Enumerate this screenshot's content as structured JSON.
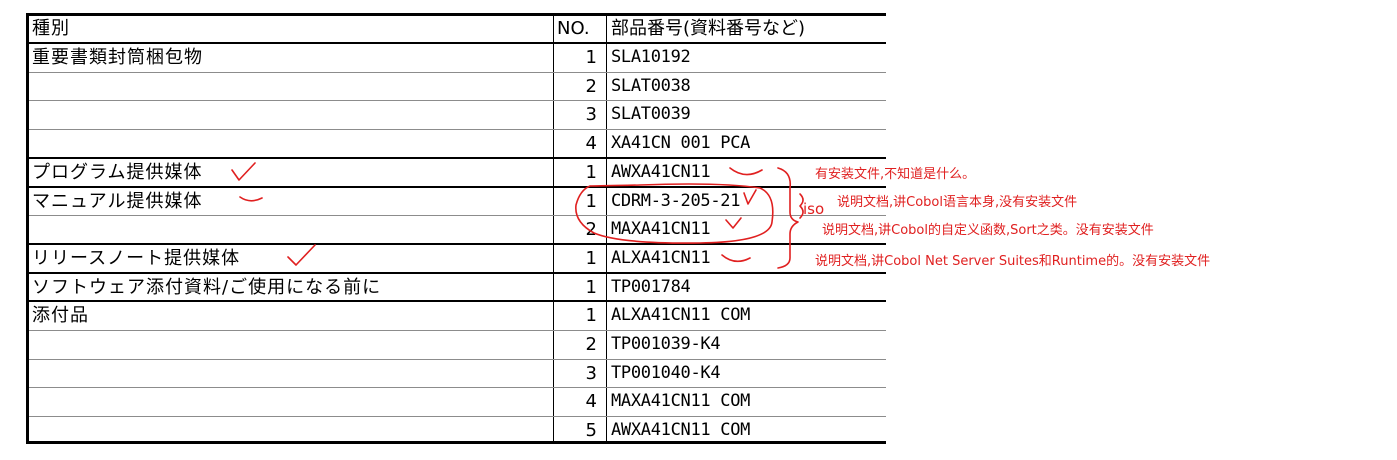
{
  "header": {
    "type_label": "種別",
    "no_label": "NO.",
    "part_label": "部品番号(資料番号など)"
  },
  "rows": [
    {
      "type": "重要書類封筒梱包物",
      "no": "1",
      "part": "SLA10192"
    },
    {
      "type": "",
      "no": "2",
      "part": "SLAT0038"
    },
    {
      "type": "",
      "no": "3",
      "part": "SLAT0039"
    },
    {
      "type": "",
      "no": "4",
      "part": "XA41CN 001 PCA"
    },
    {
      "type": "プログラム提供媒体",
      "no": "1",
      "part": "AWXA41CN11"
    },
    {
      "type": "マニュアル提供媒体",
      "no": "1",
      "part": "CDRM-3-205-21"
    },
    {
      "type": "",
      "no": "2",
      "part": "MAXA41CN11"
    },
    {
      "type": "リリースノート提供媒体",
      "no": "1",
      "part": "ALXA41CN11"
    },
    {
      "type": "ソフトウェア添付資料/ご使用になる前に",
      "no": "1",
      "part": "TP001784"
    },
    {
      "type": "添付品",
      "no": "1",
      "part": "ALXA41CN11 COM"
    },
    {
      "type": "",
      "no": "2",
      "part": "TP001039-K4"
    },
    {
      "type": "",
      "no": "3",
      "part": "TP001040-K4"
    },
    {
      "type": "",
      "no": "4",
      "part": "MAXA41CN11 COM"
    },
    {
      "type": "",
      "no": "5",
      "part": "AWXA41CN11 COM"
    }
  ],
  "annotations": {
    "color": "#e02020",
    "iso_label": "iso",
    "notes": [
      "有安装文件,不知道是什么。",
      "说明文档,讲Cobol语言本身,没有安装文件",
      "说明文档,讲Cobol的自定义函数,Sort之类。没有安装文件",
      "说明文档,讲Cobol Net Server Suites和Runtime的。没有安装文件"
    ]
  }
}
